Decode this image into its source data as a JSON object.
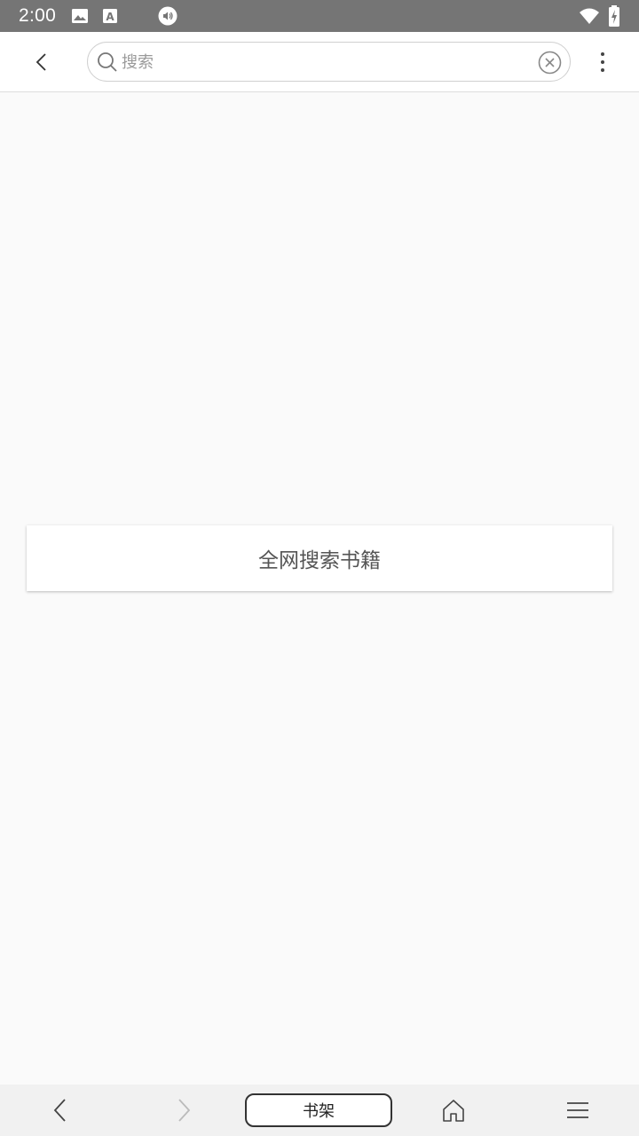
{
  "status_bar": {
    "time": "2:00",
    "icons": [
      "image-icon",
      "a-text-icon",
      "volume-icon",
      "wifi-icon",
      "battery-charging-icon"
    ]
  },
  "top_bar": {
    "back_icon": "chevron-left-icon",
    "search": {
      "placeholder": "搜索",
      "value": ""
    },
    "clear_icon": "clear-circle-icon",
    "more_icon": "more-vertical-icon"
  },
  "main": {
    "search_all_label": "全网搜索书籍"
  },
  "bottom_nav": {
    "back_icon": "chevron-left-icon",
    "forward_icon": "chevron-right-icon",
    "shelf_label": "书架",
    "home_icon": "home-icon",
    "menu_icon": "menu-icon"
  },
  "colors": {
    "status_bar_bg": "#757575",
    "page_bg": "#fafafa",
    "bottom_bar_bg": "#f1f1f1",
    "card_text": "#555555"
  }
}
